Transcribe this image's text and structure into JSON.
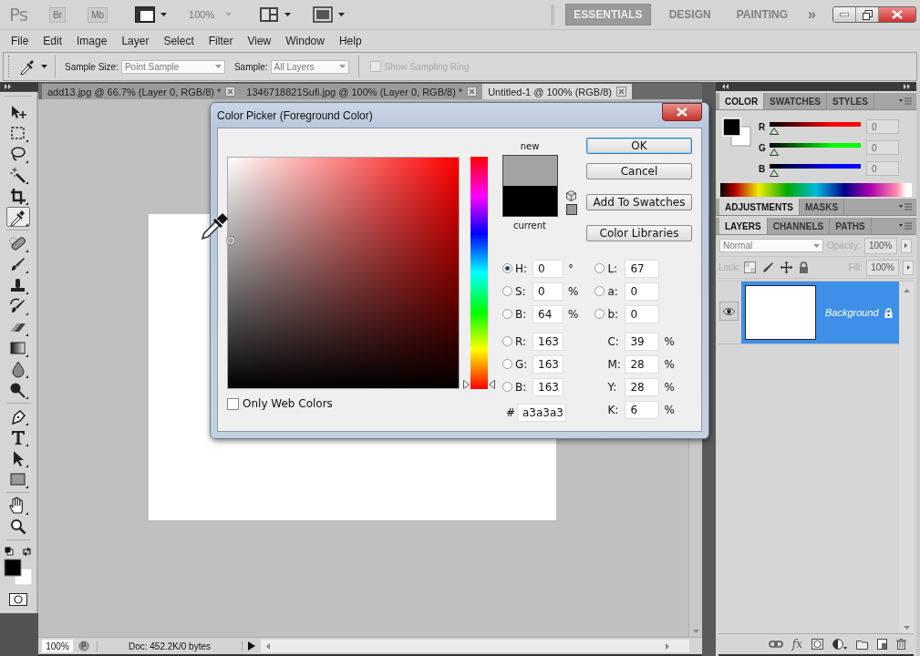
{
  "app_bar": {
    "logo": "Ps",
    "launchers": [
      "Br",
      "Mb"
    ],
    "zoom": "100%",
    "workspaces": [
      {
        "label": "ESSENTIALS",
        "selected": true
      },
      {
        "label": "DESIGN",
        "selected": false
      },
      {
        "label": "PAINTING",
        "selected": false
      }
    ],
    "more": "»"
  },
  "menu": [
    "File",
    "Edit",
    "Image",
    "Layer",
    "Select",
    "Filter",
    "View",
    "Window",
    "Help"
  ],
  "options_bar": {
    "sample_size_label": "Sample Size:",
    "sample_size": "Point Sample",
    "sample_label": "Sample:",
    "sample": "All Layers",
    "sampling_ring": {
      "label": "Show Sampling Ring",
      "checked": false,
      "disabled": true
    }
  },
  "tool_groups": [
    {
      "tools": [
        {
          "kind": "move",
          "selected": false
        },
        {
          "kind": "marquee",
          "selected": false
        },
        {
          "kind": "lasso",
          "selected": false
        },
        {
          "kind": "wand",
          "selected": false
        },
        {
          "kind": "crop",
          "selected": false
        },
        {
          "kind": "eyedropper",
          "selected": true
        }
      ]
    },
    {
      "tools": [
        {
          "kind": "heal",
          "selected": false
        },
        {
          "kind": "brush",
          "selected": false
        },
        {
          "kind": "stamp",
          "selected": false
        },
        {
          "kind": "history",
          "selected": false
        },
        {
          "kind": "eraser",
          "selected": false
        },
        {
          "kind": "gradient",
          "selected": false
        },
        {
          "kind": "blur",
          "selected": false
        },
        {
          "kind": "dodge",
          "selected": false
        }
      ]
    },
    {
      "tools": [
        {
          "kind": "pen",
          "selected": false
        },
        {
          "kind": "type",
          "selected": false
        },
        {
          "kind": "path",
          "selected": false
        },
        {
          "kind": "shape",
          "selected": false
        }
      ]
    },
    {
      "tools": [
        {
          "kind": "hand",
          "selected": false
        },
        {
          "kind": "zoom",
          "selected": false
        }
      ]
    }
  ],
  "document_tabs": [
    {
      "title": "add13.jpg @ 66.7% (Layer 0, RGB/8) *",
      "selected": false
    },
    {
      "title": "1346718821Sufi.jpg @ 100% (Layer 0, RGB/8) *",
      "selected": false
    },
    {
      "title": "Untitled-1 @ 100% (RGB/8)",
      "selected": true
    }
  ],
  "status_bar": {
    "zoom": "100%",
    "doc": "Doc: 452.2K/0 bytes"
  },
  "color_panel": {
    "tabs": [
      {
        "label": "COLOR",
        "selected": true
      },
      {
        "label": "SWATCHES",
        "selected": false
      },
      {
        "label": "STYLES",
        "selected": false
      }
    ],
    "sliders": [
      {
        "label": "R",
        "level": 0,
        "value": "0",
        "color": "#ff0000"
      },
      {
        "label": "G",
        "level": 0,
        "value": "0",
        "color": "#00ff00"
      },
      {
        "label": "B",
        "level": 0,
        "value": "0",
        "color": "#0000ff"
      }
    ]
  },
  "adjustments_panel": {
    "tabs": [
      {
        "label": "ADJUSTMENTS",
        "selected": true
      },
      {
        "label": "MASKS",
        "selected": false
      }
    ]
  },
  "layers_panel": {
    "tabs": [
      {
        "label": "LAYERS",
        "selected": true
      },
      {
        "label": "CHANNELS",
        "selected": false
      },
      {
        "label": "PATHS",
        "selected": false
      }
    ],
    "blend_mode": "Normal",
    "opacity_label": "Opacity:",
    "opacity": "100%",
    "lock_label": "Lock:",
    "fill_label": "Fill:",
    "fill": "100%",
    "layers": [
      {
        "name": "Background",
        "selected": true,
        "visible": true,
        "locked": true
      }
    ],
    "effects_label": "fx"
  },
  "color_picker": {
    "title": "Color Picker (Foreground Color)",
    "new_label": "new",
    "current_label": "current",
    "hue_slider": {
      "level": 0
    },
    "buttons": [
      {
        "label": "OK",
        "selected": true
      },
      {
        "label": "Cancel",
        "selected": false
      },
      {
        "label": "Add To Swatches",
        "selected": false
      },
      {
        "label": "Color Libraries",
        "selected": false
      }
    ],
    "fields_left": [
      {
        "label": "H:",
        "value": "0",
        "unit": "°",
        "kind": "radio",
        "selected": true
      },
      {
        "label": "S:",
        "value": "0",
        "unit": "%",
        "kind": "radio",
        "selected": false
      },
      {
        "label": "B:",
        "value": "64",
        "unit": "%",
        "kind": "radio",
        "selected": false
      },
      {
        "label": "R:",
        "value": "163",
        "kind": "radio",
        "selected": false
      },
      {
        "label": "G:",
        "value": "163",
        "kind": "radio",
        "selected": false
      },
      {
        "label": "B:",
        "value": "163",
        "kind": "radio",
        "selected": false
      }
    ],
    "fields_right": [
      {
        "label": "L:",
        "value": "67",
        "kind": "radio",
        "selected": false
      },
      {
        "label": "a:",
        "value": "0",
        "kind": "radio",
        "selected": false
      },
      {
        "label": "b:",
        "value": "0",
        "kind": "radio",
        "selected": false
      },
      {
        "label": "C:",
        "value": "39",
        "unit": "%",
        "kind": "plain"
      },
      {
        "label": "M:",
        "value": "28",
        "unit": "%",
        "kind": "plain"
      },
      {
        "label": "Y:",
        "value": "28",
        "unit": "%",
        "kind": "plain"
      },
      {
        "label": "K:",
        "value": "6",
        "unit": "%",
        "kind": "plain"
      }
    ],
    "hex_label": "#",
    "hex": "a3a3a3",
    "only_web_colors": {
      "label": "Only Web Colors",
      "checked": false
    }
  }
}
